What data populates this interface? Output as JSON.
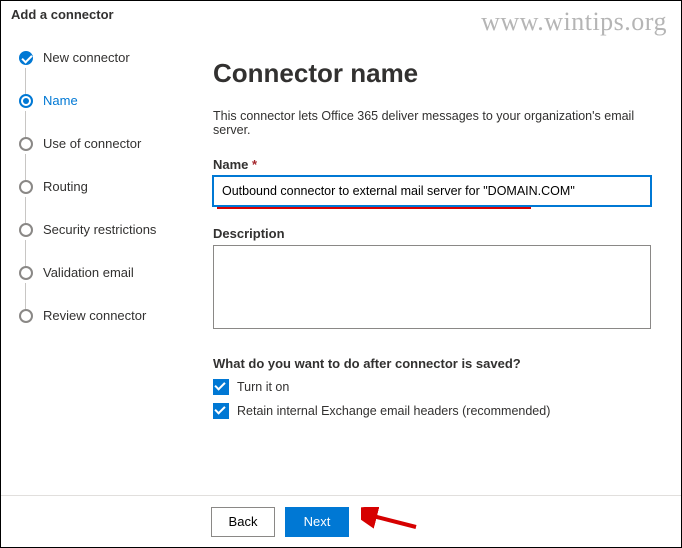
{
  "header": {
    "title": "Add a connector"
  },
  "watermark": "www.wintips.org",
  "sidebar": {
    "steps": [
      {
        "label": "New connector",
        "state": "completed"
      },
      {
        "label": "Name",
        "state": "current"
      },
      {
        "label": "Use of connector",
        "state": "upcoming"
      },
      {
        "label": "Routing",
        "state": "upcoming"
      },
      {
        "label": "Security restrictions",
        "state": "upcoming"
      },
      {
        "label": "Validation email",
        "state": "upcoming"
      },
      {
        "label": "Review connector",
        "state": "upcoming"
      }
    ]
  },
  "main": {
    "heading": "Connector name",
    "intro": "This connector lets Office 365 deliver messages to your organization's email server.",
    "name_label": "Name",
    "name_required": "*",
    "name_value": "Outbound connector to external mail server for \"DOMAIN.COM\"",
    "description_label": "Description",
    "description_value": "",
    "after_saved_label": "What do you want to do after connector is saved?",
    "option_turn_on": "Turn it on",
    "option_retain_headers": "Retain internal Exchange email headers (recommended)"
  },
  "footer": {
    "back_label": "Back",
    "next_label": "Next"
  }
}
